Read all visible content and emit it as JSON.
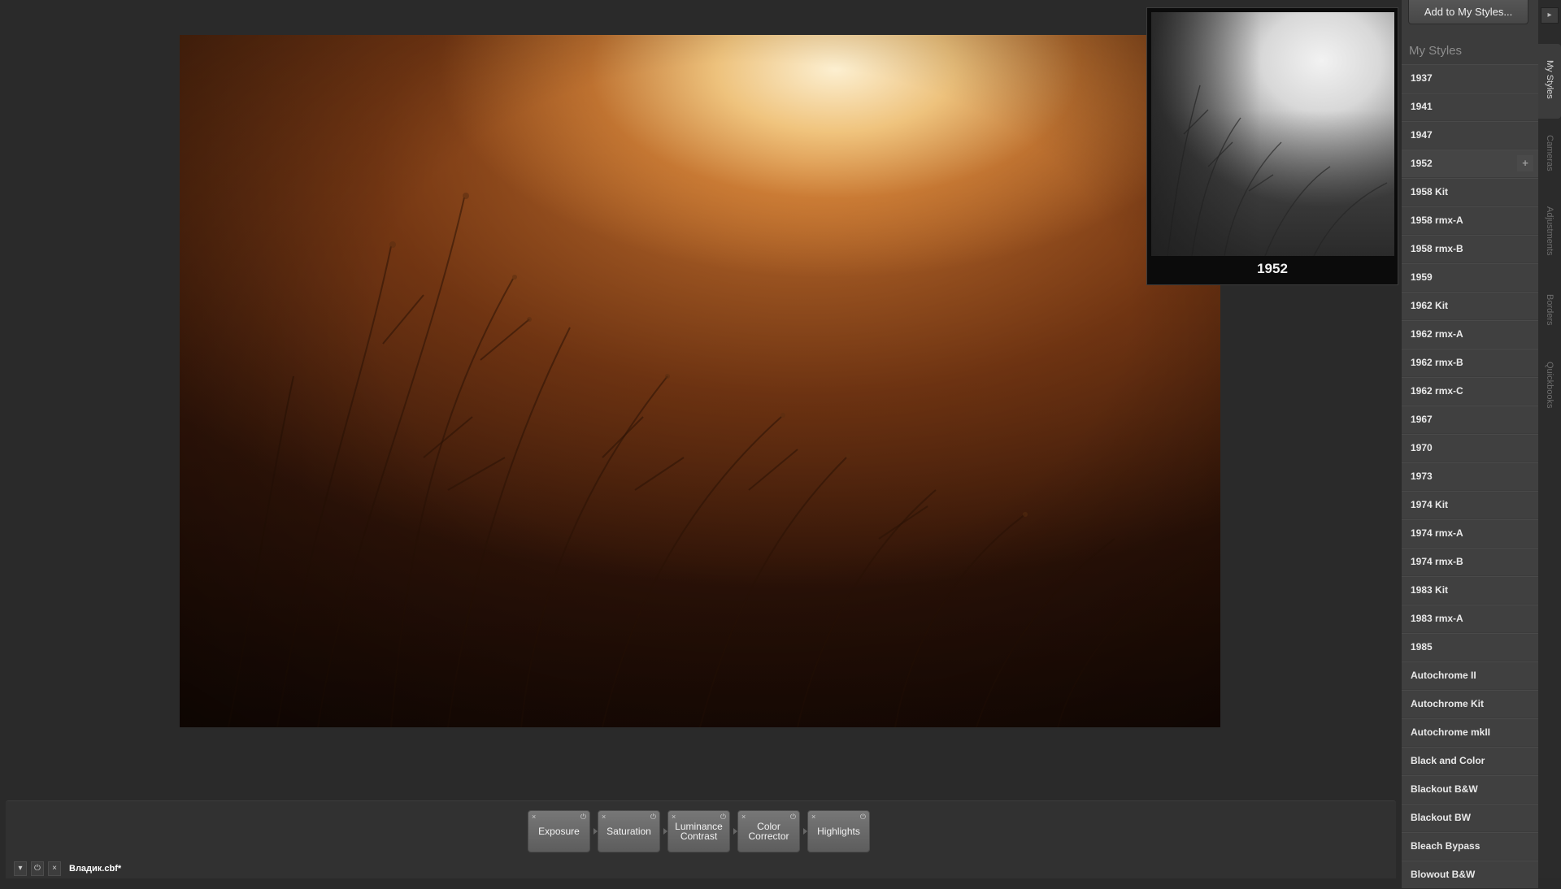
{
  "preview": {
    "style_name": "1952"
  },
  "panel": {
    "add_button_label": "Add to My Styles...",
    "title": "My Styles",
    "items": [
      "1937",
      "1941",
      "1947",
      "1952",
      "1958 Kit",
      "1958 rmx-A",
      "1958 rmx-B",
      "1959",
      "1962 Kit",
      "1962 rmx-A",
      "1962 rmx-B",
      "1962 rmx-C",
      "1967",
      "1970",
      "1973",
      "1974 Kit",
      "1974 rmx-A",
      "1974 rmx-B",
      "1983 Kit",
      "1983 rmx-A",
      "1985",
      "Autochrome II",
      "Autochrome Kit",
      "Autochrome mkII",
      "Black and Color",
      "Blackout B&W",
      "Blackout BW",
      "Bleach Bypass",
      "Blowout B&W"
    ],
    "hovered_item_plus": "+"
  },
  "vtabs": {
    "arrow": "▸",
    "items": [
      "My Styles",
      "Cameras",
      "Adjustments",
      "Borders",
      "Quickbooks"
    ]
  },
  "tools": {
    "items": [
      "Exposure",
      "Saturation",
      "Luminance Contrast",
      "Color Corrector",
      "Highlights"
    ],
    "close_glyph": "×",
    "power_glyph": "⏻"
  },
  "file": {
    "dropdown_glyph": "▾",
    "power_glyph": "⏻",
    "close_glyph": "×",
    "name": "Владик.cbf*"
  }
}
